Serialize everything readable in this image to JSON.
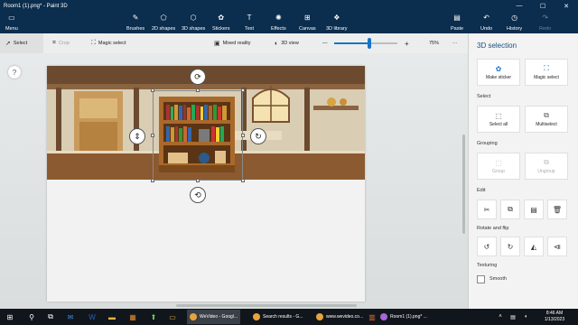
{
  "window": {
    "title": "Room1 (1).png* - Paint 3D",
    "min": "—",
    "max": "☐",
    "close": "✕"
  },
  "ribbon": {
    "menu": "Menu",
    "tools": [
      {
        "label": "Brushes",
        "icon": "✎"
      },
      {
        "label": "2D shapes",
        "icon": "⬠"
      },
      {
        "label": "3D shapes",
        "icon": "⬡"
      },
      {
        "label": "Stickers",
        "icon": "✿"
      },
      {
        "label": "Text",
        "icon": "T"
      },
      {
        "label": "Effects",
        "icon": "✺"
      },
      {
        "label": "Canvas",
        "icon": "⊞"
      },
      {
        "label": "3D library",
        "icon": "❖"
      }
    ],
    "right": [
      {
        "label": "Paste",
        "icon": "📋",
        "disabled": false
      },
      {
        "label": "Undo",
        "icon": "↶",
        "disabled": false
      },
      {
        "label": "History",
        "icon": "◷",
        "disabled": false
      },
      {
        "label": "Redo",
        "icon": "↷",
        "disabled": true
      }
    ]
  },
  "toolbar": {
    "select": "Select",
    "crop": "Crop",
    "magic_select": "Magic select",
    "mixed_reality": "Mixed reality",
    "view_3d": "3D view",
    "zoom_minus": "—",
    "zoom_plus": "+",
    "zoom": "75%",
    "zoom_fraction": 0.55,
    "more": "···"
  },
  "canvas": {
    "help": "?"
  },
  "panel": {
    "title": "3D selection",
    "make_sticker": "Make sticker",
    "magic_select": "Magic select",
    "select_section": "Select",
    "select_all": "Select all",
    "multiselect": "Multiselect",
    "grouping_section": "Grouping",
    "group": "Group",
    "ungroup": "Ungroup",
    "edit_section": "Edit",
    "rotate_section": "Rotate and flip",
    "texturing_section": "Texturing",
    "smooth": "Smooth"
  },
  "taskbar": {
    "tasks": [
      {
        "label": "WeVideo - Googl...",
        "color": "#e8a33b",
        "active": true
      },
      {
        "label": "Search results - G...",
        "color": "#e8a33b",
        "active": false
      },
      {
        "label": "www.wevideo.co...",
        "color": "#e8a33b",
        "active": false
      },
      {
        "label": "Room1 (1).png* ...",
        "color": "#a667d8",
        "active": false
      }
    ],
    "time": "8:46 AM",
    "date": "1/13/2023"
  }
}
